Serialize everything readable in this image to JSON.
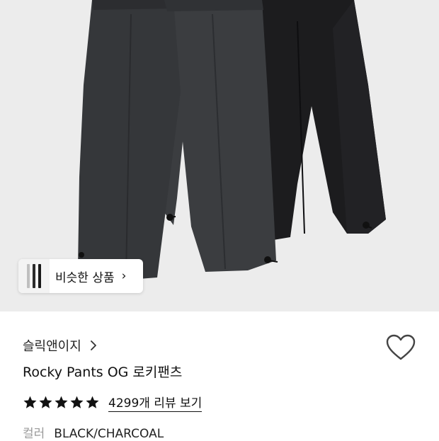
{
  "product": {
    "image_alt": "",
    "brand": "슬릭앤이지",
    "title": "Rocky Pants OG 로키팬츠",
    "rating_stars": 5,
    "review_link": "4299개 리뷰 보기",
    "color_label": "컬러",
    "color_value": "BLACK/CHARCOAL",
    "wishlisted": false
  },
  "similar": {
    "label": "비슷한 상품",
    "chevron": "›"
  },
  "icons": {
    "brand_chevron": "chevron-right-icon",
    "heart": "heart-outline-icon",
    "star": "star-filled-icon"
  },
  "colors": {
    "background": "#ececec",
    "pants_charcoal": "#3b3d40",
    "pants_black": "#1c1c1e",
    "star": "#111111"
  }
}
